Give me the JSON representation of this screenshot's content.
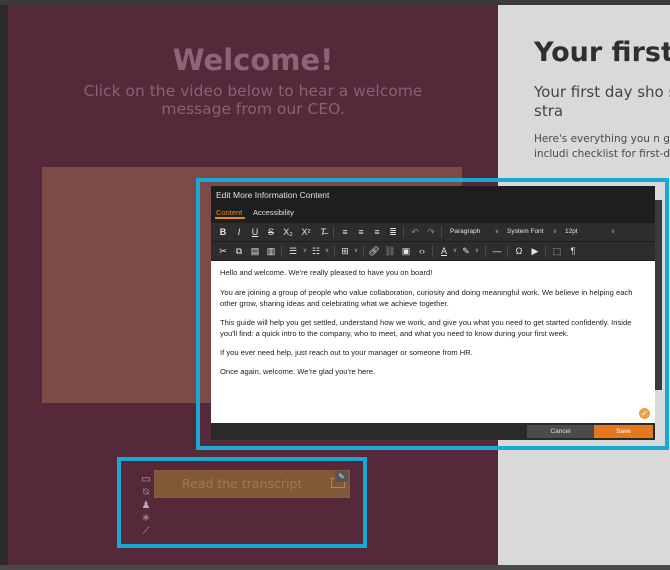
{
  "left_page": {
    "title": "Welcome!",
    "subtitle": "Click on the video below to hear a welcome message from our CEO.",
    "transcript_button": "Read the transcript",
    "side_tools": [
      "window-icon",
      "no-visibility-icon",
      "bell-icon",
      "asterisk-icon",
      "wand-icon"
    ]
  },
  "right_page": {
    "title": "Your first",
    "lead": "Your first day sho smooth and stra",
    "body": "Here's everything you n ground running, includi checklist for first-day t"
  },
  "editor": {
    "title": "Edit More Information Content",
    "tabs": [
      "Content",
      "Accessibility"
    ],
    "toolbar1": {
      "paragraph": "Paragraph",
      "font": "System Font",
      "size": "12pt"
    },
    "paragraphs": [
      "Hello and welcome. We're really pleased to have you on board!",
      "You are joining a group of people who value collaboration, curiosity and doing meaningful work. We believe in helping each other grow, sharing ideas and celebrating what we achieve together.",
      "This guide will help you get settled, understand how we work, and give you what you need to get started confidently. Inside you'll find: a quick intro to the company, who to meet, and what you need to know during your first week.",
      "If you ever need help, just reach out to your manager or someone from HR.",
      "Once again, welcome. We're glad you're here."
    ],
    "cancel": "Cancel",
    "save": "Save"
  },
  "colors": {
    "highlight": "#1aa9d2",
    "accent": "#e5781e",
    "left_bg": "#5a2b3e"
  }
}
